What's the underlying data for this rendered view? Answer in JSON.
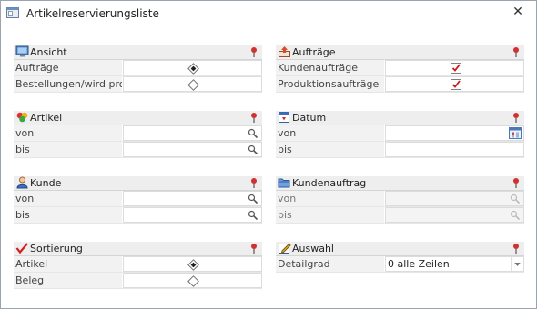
{
  "window": {
    "title": "Artikelreservierungsliste",
    "close_glyph": "✕"
  },
  "panels": {
    "ansicht": {
      "title": "Ansicht",
      "icon": "monitor-icon",
      "rows": [
        {
          "label": "Aufträge",
          "state": "selected"
        },
        {
          "label": "Bestellungen/wird prod.",
          "state": "unselected"
        }
      ]
    },
    "auftraege": {
      "title": "Aufträge",
      "icon": "order-upload-icon",
      "rows": [
        {
          "label": "Kundenaufträge",
          "checked": true
        },
        {
          "label": "Produktionsaufträge",
          "checked": true
        }
      ]
    },
    "artikel": {
      "title": "Artikel",
      "icon": "articles-icon",
      "rows": [
        {
          "label": "von",
          "value": ""
        },
        {
          "label": "bis",
          "value": ""
        }
      ]
    },
    "datum": {
      "title": "Datum",
      "icon": "calendar-icon",
      "rows": [
        {
          "label": "von",
          "value": ""
        },
        {
          "label": "bis",
          "value": ""
        }
      ]
    },
    "kunde": {
      "title": "Kunde",
      "icon": "customer-icon",
      "rows": [
        {
          "label": "von",
          "value": ""
        },
        {
          "label": "bis",
          "value": ""
        }
      ]
    },
    "kundenauftrag": {
      "title": "Kundenauftrag",
      "icon": "folder-icon",
      "rows": [
        {
          "label": "von",
          "value": ""
        },
        {
          "label": "bis",
          "value": ""
        }
      ]
    },
    "sortierung": {
      "title": "Sortierung",
      "icon": "sort-check-icon",
      "rows": [
        {
          "label": "Artikel",
          "state": "selected"
        },
        {
          "label": "Beleg",
          "state": "unselected"
        }
      ]
    },
    "auswahl": {
      "title": "Auswahl",
      "icon": "edit-icon",
      "rows": [
        {
          "label": "Detailgrad",
          "value": "0 alle Zeilen"
        }
      ]
    }
  }
}
